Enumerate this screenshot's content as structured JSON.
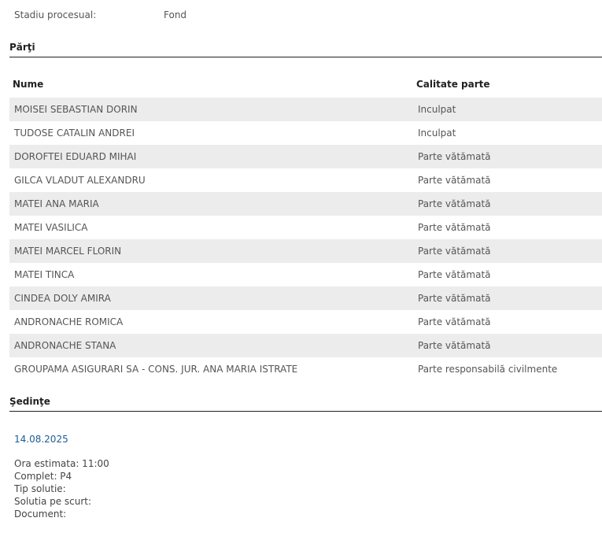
{
  "stadiu": {
    "label": "Stadiu procesual:",
    "value": "Fond"
  },
  "parti": {
    "title": "Părţi",
    "headers": {
      "name": "Nume",
      "role": "Calitate parte"
    },
    "rows": [
      {
        "name": "MOISEI SEBASTIAN DORIN",
        "role": "Inculpat"
      },
      {
        "name": "TUDOSE CATALIN ANDREI",
        "role": "Inculpat"
      },
      {
        "name": "DOROFTEI EDUARD MIHAI",
        "role": "Parte vătămată"
      },
      {
        "name": "GILCA VLADUT ALEXANDRU",
        "role": "Parte vătămată"
      },
      {
        "name": "MATEI ANA MARIA",
        "role": "Parte vătămată"
      },
      {
        "name": "MATEI VASILICA",
        "role": "Parte vătămată"
      },
      {
        "name": "MATEI MARCEL FLORIN",
        "role": "Parte vătămată"
      },
      {
        "name": "MATEI TINCA",
        "role": "Parte vătămată"
      },
      {
        "name": "CINDEA DOLY AMIRA",
        "role": "Parte vătămată"
      },
      {
        "name": "ANDRONACHE ROMICA",
        "role": "Parte vătămată"
      },
      {
        "name": "ANDRONACHE STANA",
        "role": "Parte vătămată"
      },
      {
        "name": "GROUPAMA ASIGURARI SA - CONS. JUR. ANA MARIA ISTRATE",
        "role": "Parte responsabilă civilmente"
      }
    ]
  },
  "sedinte": {
    "title": "Şedinţe",
    "date": "14.08.2025",
    "details": [
      "Ora estimata: 11:00",
      "Complet: P4",
      "Tip solutie:",
      "Solutia pe scurt:",
      "Document:"
    ]
  },
  "colors": {
    "link": "#1a5d96",
    "stripe": "#ececec",
    "rule": "#222222"
  }
}
